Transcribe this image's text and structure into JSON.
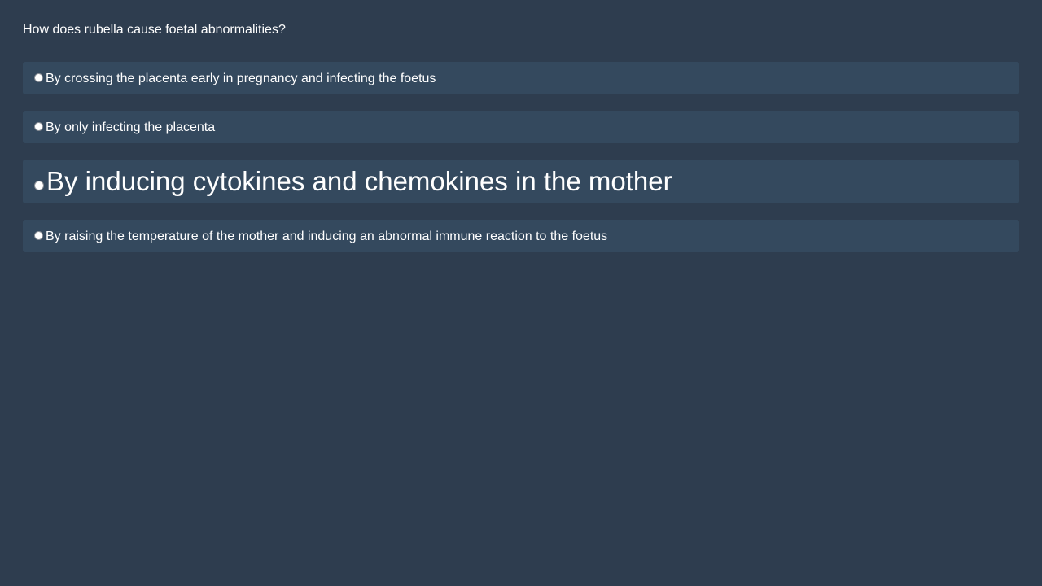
{
  "quiz": {
    "question": "How does rubella cause foetal abnormalities?",
    "options": [
      {
        "label": "By crossing the placenta early in pregnancy and infecting the foetus",
        "selected": false
      },
      {
        "label": "By only infecting the placenta",
        "selected": false
      },
      {
        "label": "By inducing cytokines and chemokines in the mother",
        "selected": false
      },
      {
        "label": "By raising the temperature of the mother and inducing an abnormal immune reaction to the foetus",
        "selected": false
      }
    ]
  },
  "colors": {
    "background": "#2e3d4f",
    "option_background": "#34495e",
    "text": "#ffffff"
  }
}
